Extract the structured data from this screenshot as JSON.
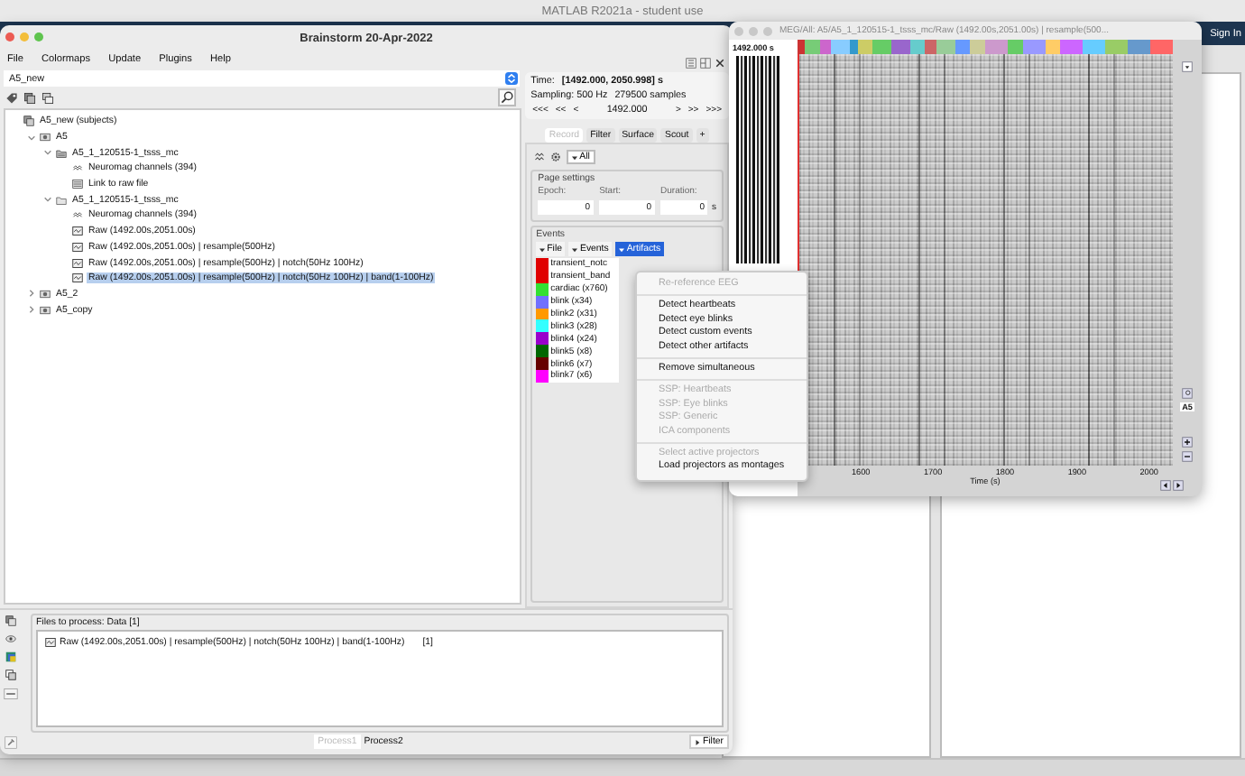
{
  "matlab": {
    "title": "MATLAB R2021a - student use",
    "sign_in": "Sign In"
  },
  "brainstorm": {
    "title": "Brainstorm 20-Apr-2022",
    "menu": [
      "File",
      "Colormaps",
      "Update",
      "Plugins",
      "Help"
    ],
    "protocol": "A5_new",
    "tree": [
      {
        "label": "A5_new (subjects)",
        "kind": "subjects",
        "selected": false,
        "children": [
          {
            "label": "A5",
            "kind": "subject",
            "selected": false,
            "expanded": true,
            "children": [
              {
                "label": "A5_1_120515-1_tsss_mc",
                "kind": "condition",
                "selected": false,
                "expanded": true,
                "children": [
                  {
                    "label": "Neuromag channels (394)",
                    "kind": "channel",
                    "selected": false
                  },
                  {
                    "label": "Link to raw file",
                    "kind": "link",
                    "selected": false
                  }
                ]
              },
              {
                "label": "A5_1_120515-1_tsss_mc",
                "kind": "folder",
                "selected": false,
                "expanded": true,
                "children": [
                  {
                    "label": "Neuromag channels (394)",
                    "kind": "channel",
                    "selected": false
                  },
                  {
                    "label": "Raw (1492.00s,2051.00s)",
                    "kind": "data",
                    "selected": false
                  },
                  {
                    "label": "Raw (1492.00s,2051.00s) | resample(500Hz)",
                    "kind": "data",
                    "selected": false
                  },
                  {
                    "label": "Raw (1492.00s,2051.00s) | resample(500Hz) | notch(50Hz 100Hz)",
                    "kind": "data",
                    "selected": false
                  },
                  {
                    "label": "Raw (1492.00s,2051.00s) | resample(500Hz) | notch(50Hz 100Hz) | band(1-100Hz)",
                    "kind": "data",
                    "selected": true
                  }
                ]
              }
            ]
          },
          {
            "label": "A5_2",
            "kind": "subject",
            "selected": false,
            "expanded": false
          },
          {
            "label": "A5_copy",
            "kind": "subject",
            "selected": false,
            "expanded": false
          }
        ]
      }
    ],
    "record": {
      "time_label": "Time:",
      "time": "[1492.000, 2050.998] s",
      "sampling": "Sampling: 500 Hz",
      "samples": "279500 samples",
      "nav_back": [
        "<<<",
        "<<",
        "<"
      ],
      "time_value": "1492.000",
      "nav_forward": [
        ">",
        ">>",
        ">>>"
      ],
      "tabs": [
        {
          "label": "Record",
          "selected": true
        },
        {
          "label": "Filter",
          "selected": false
        },
        {
          "label": "Surface",
          "selected": false
        },
        {
          "label": "Scout",
          "selected": false
        },
        {
          "label": "+",
          "selected": false
        }
      ],
      "montage": "All",
      "page_settings": {
        "title": "Page settings",
        "fields": [
          {
            "label": "Epoch:",
            "value": "0"
          },
          {
            "label": "Start:",
            "value": "0"
          },
          {
            "label": "Duration:",
            "value": "0",
            "unit": "s"
          }
        ]
      },
      "events": {
        "title": "Events",
        "menus": [
          {
            "label": "File",
            "selected": false
          },
          {
            "label": "Events",
            "selected": false
          },
          {
            "label": "Artifacts",
            "selected": true
          }
        ],
        "list": [
          {
            "name": "transient_notc",
            "color": "#e00000"
          },
          {
            "name": "transient_band",
            "color": "#e00000"
          },
          {
            "name": "cardiac (x760)",
            "color": "#33e033"
          },
          {
            "name": "blink (x34)",
            "color": "#7070ff"
          },
          {
            "name": "blink2 (x31)",
            "color": "#ff9900"
          },
          {
            "name": "blink3 (x28)",
            "color": "#33ffff"
          },
          {
            "name": "blink4 (x24)",
            "color": "#9900cc"
          },
          {
            "name": "blink5 (x8)",
            "color": "#006600"
          },
          {
            "name": "blink6 (x7)",
            "color": "#660000"
          },
          {
            "name": "blink7 (x6)",
            "color": "#ff00ff"
          }
        ]
      }
    },
    "artifacts_menu": {
      "groups": [
        [
          {
            "label": "Re-reference EEG",
            "disabled": true
          }
        ],
        [
          {
            "label": "Detect heartbeats",
            "disabled": false
          },
          {
            "label": "Detect eye blinks",
            "disabled": false
          },
          {
            "label": "Detect custom events",
            "disabled": false
          },
          {
            "label": "Detect other artifacts",
            "disabled": false
          }
        ],
        [
          {
            "label": "Remove simultaneous",
            "disabled": false
          }
        ],
        [
          {
            "label": "SSP: Heartbeats",
            "disabled": true
          },
          {
            "label": "SSP: Eye blinks",
            "disabled": true
          },
          {
            "label": "SSP: Generic",
            "disabled": true
          },
          {
            "label": "ICA components",
            "disabled": true
          }
        ],
        [
          {
            "label": "Select active projectors",
            "disabled": true
          },
          {
            "label": "Load projectors as montages",
            "disabled": false
          }
        ]
      ]
    },
    "process": {
      "title": "Files to process: Data [1]",
      "files": [
        {
          "label": "Raw (1492.00s,2051.00s) | resample(500Hz) | notch(50Hz 100Hz) | band(1-100Hz)",
          "count": "[1]"
        }
      ],
      "tabs": [
        {
          "label": "Process1",
          "selected": true
        },
        {
          "label": "Process2",
          "selected": false
        }
      ],
      "filter": "Filter"
    }
  },
  "viewer": {
    "title": "MEG/All: A5/A5_1_120515-1_tsss_mc/Raw (1492.00s,2051.00s) | resample(500...",
    "time_cursor": "1492.000 s",
    "xticks": [
      "1600",
      "1700",
      "1800",
      "1900",
      "2000"
    ],
    "xlabel": "Time (s)",
    "montage": "A5"
  }
}
